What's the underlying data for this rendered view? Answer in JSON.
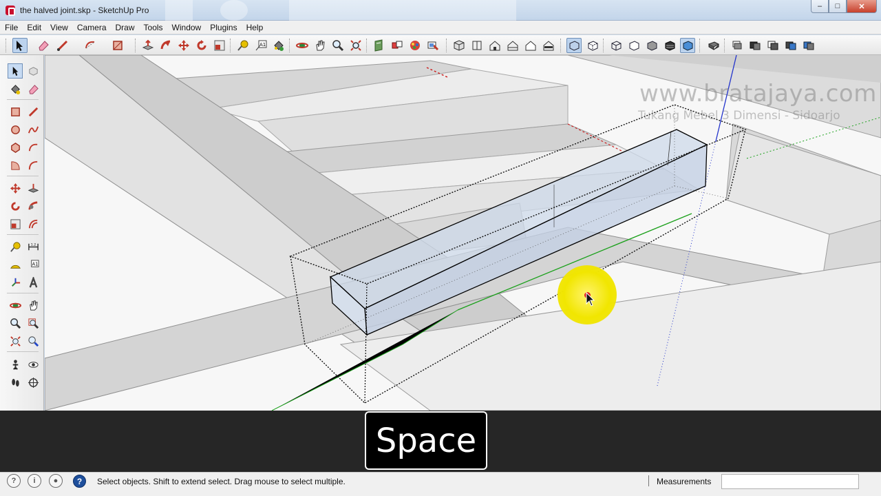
{
  "window": {
    "title": "the halved joint.skp - SketchUp Pro",
    "minimize_label": "–",
    "maximize_label": "□",
    "close_label": "✕"
  },
  "menubar": {
    "items": [
      "File",
      "Edit",
      "View",
      "Camera",
      "Draw",
      "Tools",
      "Window",
      "Plugins",
      "Help"
    ]
  },
  "toolbar": {
    "icons": [
      "select-icon",
      "eraser-icon",
      "line-icon",
      "arc-icon",
      "rectangle-icon",
      "push-pull-icon",
      "follow-me-icon",
      "move-icon",
      "rotate-icon",
      "scale-icon",
      "tape-measure-icon",
      "text-icon",
      "paint-bucket-icon",
      "orbit-icon",
      "pan-icon",
      "zoom-icon",
      "zoom-extents-icon",
      "section-plane-icon",
      "components-icon",
      "materials-icon",
      "styles-icon",
      "iso-view-icon",
      "top-view-icon",
      "front-view-icon",
      "right-view-icon",
      "back-view-icon",
      "left-view-icon",
      "xray-icon",
      "back-edges-icon",
      "wireframe-icon",
      "hidden-line-icon",
      "shaded-icon",
      "shaded-textures-icon",
      "monochrome-icon",
      "model-info-icon",
      "layers-icon",
      "outliner-icon",
      "scenes-icon",
      "shadows-icon",
      "fog-icon"
    ]
  },
  "viewport": {
    "watermark_url": "www.bratajaya.com",
    "watermark_tagline": "Tukang Mebel 3 Dimensi - Sidoarjo"
  },
  "caption": {
    "key": "Space"
  },
  "statusbar": {
    "message": "Select objects. Shift to extend select. Drag mouse to select multiple.",
    "measurements_label": "Measurements",
    "measurements_value": ""
  },
  "colors": {
    "axis_red": "#cc2222",
    "axis_green": "#1aa01a",
    "axis_blue": "#2233cc",
    "cursor_highlight": "#f1e600",
    "selection": "#cfdcee"
  }
}
